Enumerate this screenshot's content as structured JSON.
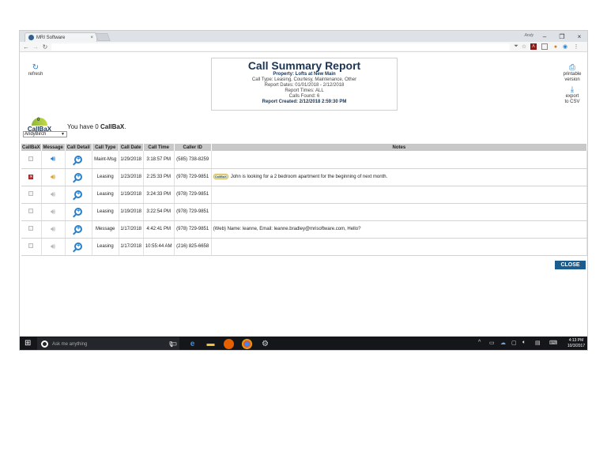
{
  "browser": {
    "tab_title": "MRI Software",
    "tab_close": "×",
    "window_label": "Andy",
    "minimize": "–",
    "maximize": "❐",
    "close": "×"
  },
  "toolbar": {
    "refresh_label": "refresh",
    "printable_label_1": "printable",
    "printable_label_2": "version",
    "export_label_1": "export",
    "export_label_2": "to CSV"
  },
  "summary": {
    "title": "Call Summary Report",
    "property": "Property: Lofts at New Main",
    "call_type": "Call Type: Leasing, Courtesy, Maintenance, Other",
    "report_dates": "Report Dates: 01/01/2018 - 2/12/2018",
    "report_times": "Report Times: ALL",
    "calls_found": "Calls Found: 6",
    "report_created": "Report Created: 2/12/2018 2:59:30 PM"
  },
  "callbax": {
    "logo_text": "CallBaX",
    "logo_count": "0",
    "message_prefix": "You have 0 ",
    "message_bold": "CallBaX",
    "message_suffix": ".",
    "user_selected": "AndyBirch"
  },
  "table": {
    "headers": [
      "CallBaX",
      "Message",
      "Call Detail",
      "Call Type",
      "Call Date",
      "Call Time",
      "Caller ID",
      "Notes"
    ],
    "rows": [
      {
        "type": "Maint-Msg",
        "date": "1/29/2018",
        "time": "3:18:57 PM",
        "caller": "(585) 738-8259",
        "notes": ""
      },
      {
        "type": "Leasing",
        "date": "1/23/2018",
        "time": "2:25:33 PM",
        "caller": "(978) 729-9851",
        "notes": "John is looking for a 2 bedroom apartment for the beginning of next month."
      },
      {
        "type": "Leasing",
        "date": "1/19/2018",
        "time": "3:24:33 PM",
        "caller": "(978) 729-9851",
        "notes": ""
      },
      {
        "type": "Leasing",
        "date": "1/19/2018",
        "time": "3:22:54 PM",
        "caller": "(978) 729-9851",
        "notes": ""
      },
      {
        "type": "Message",
        "date": "1/17/2018",
        "time": "4:42:41 PM",
        "caller": "(978) 729-9851",
        "notes": "(Web) Name: leanne, Email: leanne.bradley@mrisoftware.com, Hello?"
      },
      {
        "type": "Leasing",
        "date": "1/17/2018",
        "time": "10:55:44 AM",
        "caller": "(216) 825-6658",
        "notes": ""
      }
    ],
    "callbax_badge": "CallBaX"
  },
  "close_label": "CLOSE",
  "taskbar": {
    "search_placeholder": "Ask me anything",
    "time": "4:13 PM",
    "date": "10/3/2017"
  },
  "colors": {
    "accent": "#2a7fc9",
    "title_navy": "#1a3556",
    "close_button": "#1b5d8f",
    "header_gray": "#c8c8c8"
  },
  "icons": [
    "refresh-icon",
    "printer-icon",
    "download-icon",
    "speaker-icon",
    "zoom-in-icon",
    "windows-start-icon",
    "cortana-icon",
    "microphone-icon",
    "edge-icon",
    "file-explorer-icon",
    "firefox-icon",
    "chrome-icon",
    "settings-icon"
  ]
}
